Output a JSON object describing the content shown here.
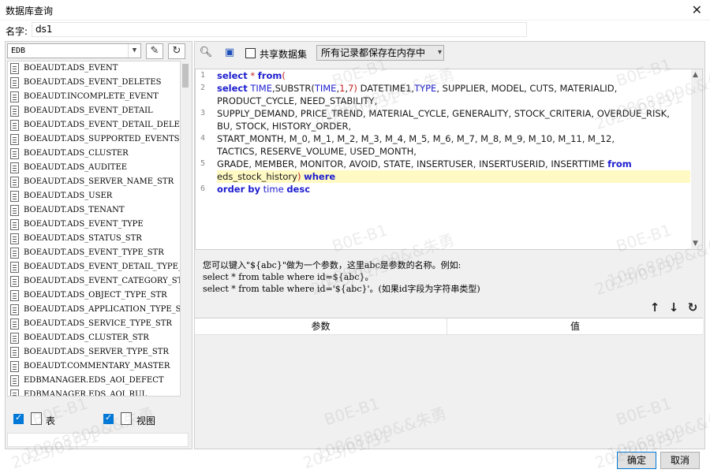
{
  "window": {
    "title": "数据库查询",
    "close_glyph": "✕"
  },
  "name_field": {
    "label": "名字:",
    "value": "ds1"
  },
  "left": {
    "datasource": "EDB",
    "tables": [
      "BOEAUDT.ADS_EVENT",
      "BOEAUDT.ADS_EVENT_DELETES",
      "BOEAUDT.INCOMPLETE_EVENT",
      "BOEAUDT.ADS_EVENT_DETAIL",
      "BOEAUDT.ADS_EVENT_DETAIL_DELETES",
      "BOEAUDT.ADS_SUPPORTED_EVENTS",
      "BOEAUDT.ADS_CLUSTER",
      "BOEAUDT.ADS_AUDITEE",
      "BOEAUDT.ADS_SERVER_NAME_STR",
      "BOEAUDT.ADS_USER",
      "BOEAUDT.ADS_TENANT",
      "BOEAUDT.ADS_EVENT_TYPE",
      "BOEAUDT.ADS_STATUS_STR",
      "BOEAUDT.ADS_EVENT_TYPE_STR",
      "BOEAUDT.ADS_EVENT_DETAIL_TYPE_STR",
      "BOEAUDT.ADS_EVENT_CATEGORY_STR",
      "BOEAUDT.ADS_OBJECT_TYPE_STR",
      "BOEAUDT.ADS_APPLICATION_TYPE_STR",
      "BOEAUDT.ADS_SERVICE_TYPE_STR",
      "BOEAUDT.ADS_CLUSTER_STR",
      "BOEAUDT.ADS_SERVER_TYPE_STR",
      "BOEAUDT.COMMENTARY_MASTER",
      "EDBMANAGER.EDS_AOI_DEFECT",
      "EDBMANAGER.EDS_AOI_RUL"
    ],
    "show_table_label": "表",
    "show_view_label": "视图"
  },
  "right": {
    "share_label": "共享数据集",
    "memory_option": "所有记录都保存在内存中",
    "sql_lines": [
      {
        "n": "1",
        "tokens": [
          [
            "kw",
            "select"
          ],
          [
            "plain",
            " "
          ],
          [
            "par",
            "*"
          ],
          [
            "plain",
            " "
          ],
          [
            "kw",
            "from"
          ],
          [
            "par",
            "("
          ]
        ]
      },
      {
        "n": "2",
        "tokens": [
          [
            "kw",
            "select"
          ],
          [
            "plain",
            " "
          ],
          [
            "fn",
            "TIME"
          ],
          [
            "plain",
            ",SUBSTR("
          ],
          [
            "fn",
            "TIME"
          ],
          [
            "plain",
            ","
          ],
          [
            "num",
            "1"
          ],
          [
            "plain",
            ","
          ],
          [
            "num",
            "7"
          ],
          [
            "par",
            ")"
          ],
          [
            "plain",
            " DATETIME1,"
          ],
          [
            "fn",
            "TYPE"
          ],
          [
            "plain",
            ", SUPPLIER, MODEL, CUTS, MATERIALID,"
          ]
        ]
      },
      {
        "n": "",
        "tokens": [
          [
            "plain",
            "PRODUCT_CYCLE, NEED_STABILITY,"
          ]
        ]
      },
      {
        "n": "3",
        "tokens": [
          [
            "plain",
            "SUPPLY_DEMAND, PRICE_TREND, MATERIAL_CYCLE, GENERALITY, STOCK_CRITERIA, OVERDUE_RISK,"
          ]
        ]
      },
      {
        "n": "",
        "tokens": [
          [
            "plain",
            "BU, STOCK, HISTORY_ORDER,"
          ]
        ]
      },
      {
        "n": "4",
        "tokens": [
          [
            "plain",
            "START_MONTH, M_0, M_1, M_2, M_3, M_4, M_5, M_6, M_7, M_8, M_9, M_10, M_11, M_12,"
          ]
        ]
      },
      {
        "n": "",
        "tokens": [
          [
            "plain",
            "TACTICS, RESERVE_VOLUME, USED_MONTH,"
          ]
        ]
      },
      {
        "n": "5",
        "tokens": [
          [
            "plain",
            "GRADE, MEMBER, MONITOR, AVOID, STATE, INSERTUSER, INSERTUSERID, INSERTTIME "
          ],
          [
            "kw",
            "from"
          ]
        ]
      },
      {
        "n": "",
        "hl": true,
        "tokens": [
          [
            "plain",
            "eds_stock_history"
          ],
          [
            "par",
            ")"
          ],
          [
            "plain",
            " "
          ],
          [
            "kw",
            "where"
          ]
        ]
      },
      {
        "n": "6",
        "tokens": [
          [
            "kw",
            "order by"
          ],
          [
            "plain",
            " "
          ],
          [
            "fn",
            "time"
          ],
          [
            "plain",
            " "
          ],
          [
            "kw",
            "desc"
          ]
        ]
      }
    ],
    "hint_lines": [
      "您可以键入\"${abc}\"做为一个参数，这里abc是参数的名称。例如:",
      "select * from table where id=${abc}。",
      "select * from table where id='${abc}'。(如果id字段为字符串类型)"
    ],
    "param_header": "参数",
    "value_header": "值"
  },
  "footer": {
    "ok": "确定",
    "cancel": "取消"
  },
  "watermarks": [
    "B0E-B1",
    "10868809&&朱勇",
    "2023/01/31"
  ]
}
